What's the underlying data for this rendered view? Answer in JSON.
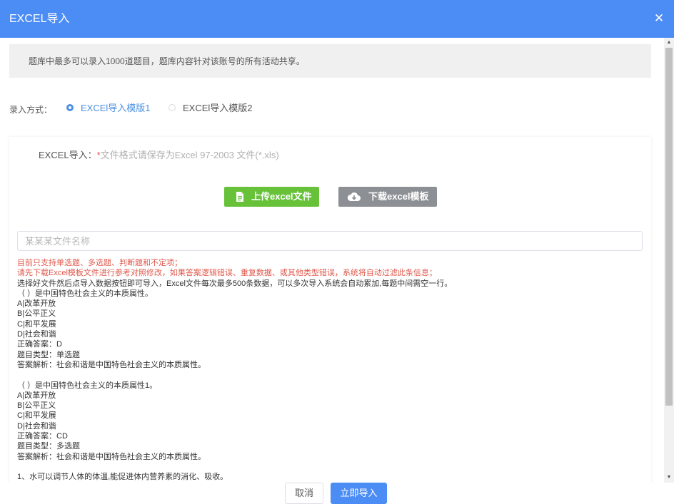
{
  "dialog": {
    "title": "EXCEL导入",
    "close_icon": "close-icon"
  },
  "notice": "题库中最多可以录入1000道题目，题库内容针对该账号的所有活动共享。",
  "import_mode": {
    "label": "录入方式：",
    "options": [
      {
        "label": "EXCEl导入模版1",
        "selected": true
      },
      {
        "label": "EXCEl导入模版2",
        "selected": false
      }
    ]
  },
  "excel": {
    "label": "EXCEL导入：",
    "required_mark": "*",
    "hint": "文件格式请保存为Excel 97-2003 文件(*.xls)",
    "upload_button": "上传excel文件",
    "download_button": "下载excel模板",
    "filename_placeholder": "某某某文件名称"
  },
  "instructions": {
    "red_lines": [
      "目前只支持单选题、多选题、判断题和不定项；",
      "请先下载Excel模板文件进行参考对照修改，如果答案逻辑错误、重复数据、或其他类型错误，系统将自动过滤此条信息；"
    ],
    "lines": [
      "选择好文件然后点导入数据按钮即可导入，Excel文件每次最多500条数据，可以多次导入系统会自动累加,每题中间需空一行。",
      "（ ）是中国特色社会主义的本质属性。",
      "A|改革开放",
      "B|公平正义",
      "C|和平发展",
      "D|社会和谐",
      "正确答案：D",
      "题目类型：单选题",
      "答案解析：社会和谐是中国特色社会主义的本质属性。",
      "",
      "（ ）是中国特色社会主义的本质属性1。",
      "A|改革开放",
      "B|公平正义",
      "C|和平发展",
      "D|社会和谐",
      "正确答案：CD",
      "题目类型：多选题",
      "答案解析：社会和谐是中国特色社会主义的本质属性。",
      "",
      "1、水可以调节人体的体温,能促进体内营养素的消化、吸收。"
    ]
  },
  "footer": {
    "cancel": "取消",
    "import": "立即导入"
  },
  "colors": {
    "header": "#4c8cf5",
    "upload": "#67c23a",
    "download": "#8c8f94",
    "warning": "#e0584c",
    "link": "#4a90e2"
  }
}
